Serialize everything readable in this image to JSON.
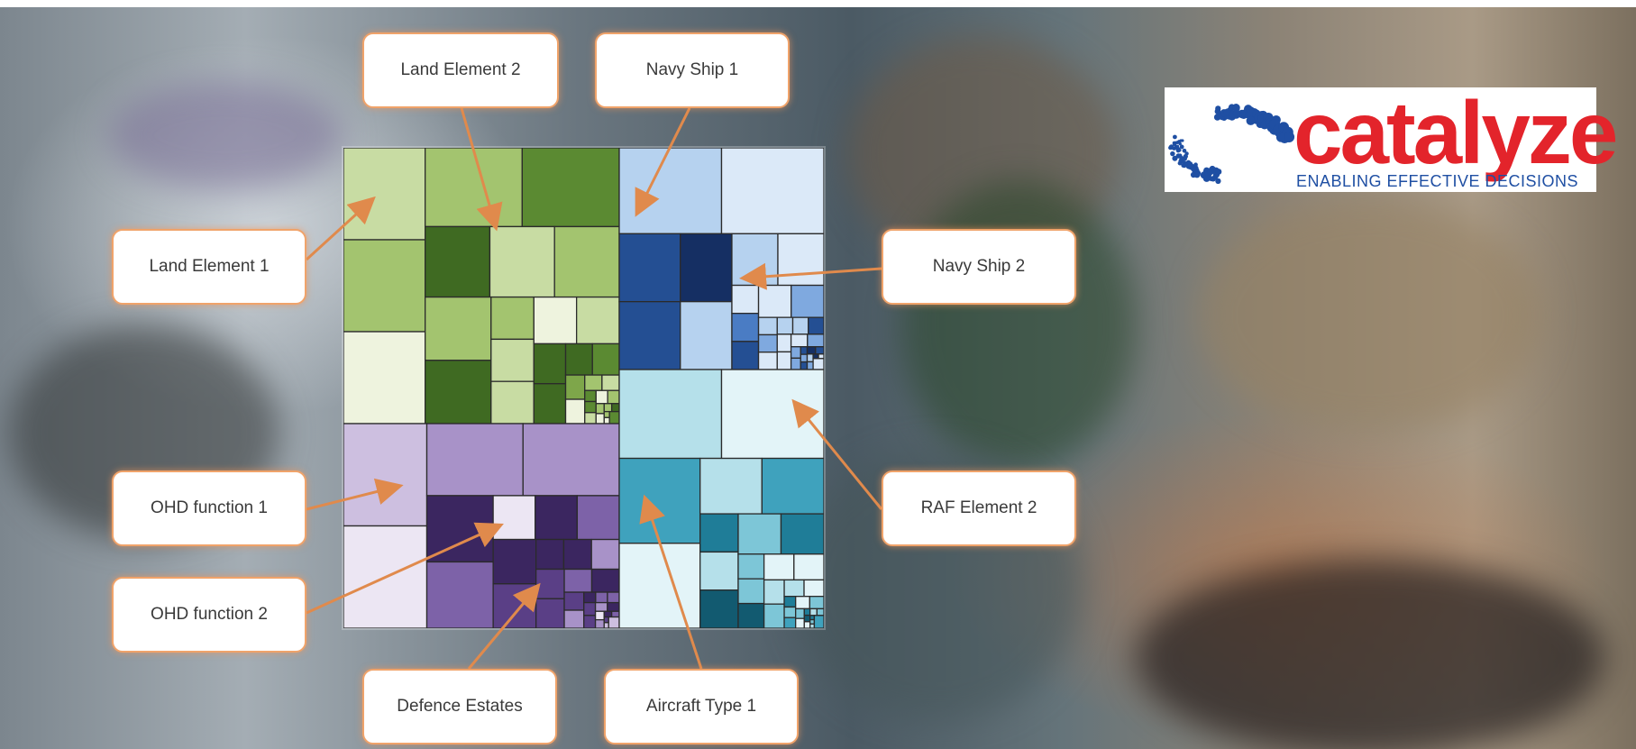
{
  "callouts": {
    "land_element_2": "Land Element 2",
    "navy_ship_1": "Navy Ship 1",
    "land_element_1": "Land Element 1",
    "navy_ship_2": "Navy Ship 2",
    "ohd_function_1": "OHD function 1",
    "ohd_function_2": "OHD function 2",
    "raf_element_2": "RAF Element 2",
    "defence_estates": "Defence Estates",
    "aircraft_type_1": "Aircraft Type 1"
  },
  "logo": {
    "word": "catalyze",
    "tagline": "ENABLING EFFECTIVE DECISIONS"
  },
  "colors": {
    "callout_border": "#f0a36a",
    "arrow": "#e08a4c",
    "logo_red": "#e3242b",
    "logo_blue": "#1f4fa3",
    "green_palette": [
      "#eef3de",
      "#c8dca3",
      "#a3c46f",
      "#7ea64a",
      "#5b8a32",
      "#3f6a22"
    ],
    "blue_palette": [
      "#dbe9f8",
      "#b6d2ef",
      "#7fa9df",
      "#4a7cc4",
      "#244f93",
      "#152f63"
    ],
    "purple_palette": [
      "#ece6f3",
      "#cdbfe0",
      "#a892c8",
      "#7d62a8",
      "#5a3f86",
      "#3b2660"
    ],
    "teal_palette": [
      "#e3f4f8",
      "#b5e0ea",
      "#7dc6d7",
      "#3fa2bd",
      "#1f7d98",
      "#125a70"
    ]
  }
}
